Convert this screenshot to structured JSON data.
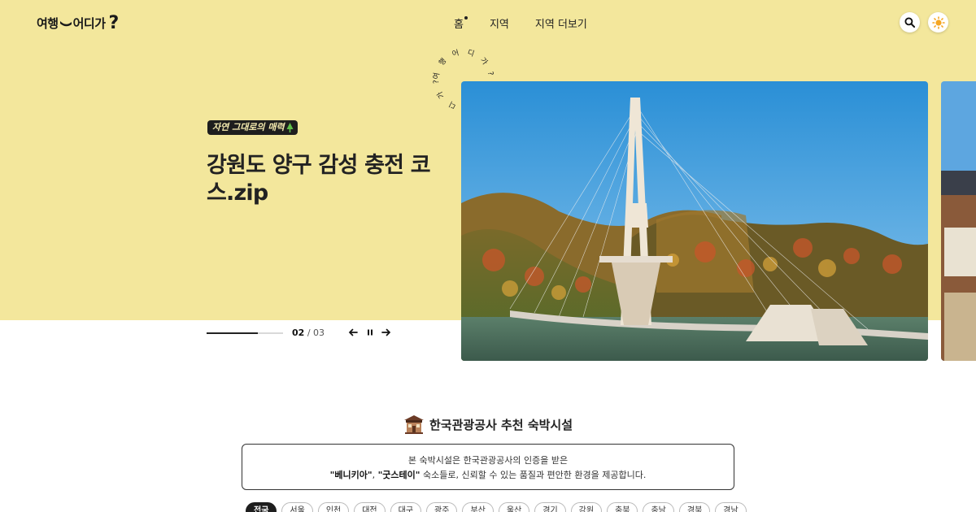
{
  "header": {
    "logo": {
      "part1": "여행",
      "part2": "어디가",
      "part3": "?"
    },
    "nav": [
      "홈",
      "지역",
      "지역 더보기"
    ],
    "active_nav": "홈"
  },
  "hero": {
    "circle_text": "여 행 어 디 가 ? 여 행 어 디 가 ?",
    "badge": "자연 그대로의 매력",
    "badge_icon": "tree-icon",
    "title": "강원도 양구 감성 충전 코스.zip",
    "slide_current": "02",
    "slide_separator": "/",
    "slide_total": "03",
    "progress": 0.67
  },
  "section": {
    "title": "한국관광공사 추천 숙박시설",
    "icon": "hanok-building-icon",
    "info_line1": "본 숙박시설은 한국관광공사의 인증을 받은",
    "info_brand1": "\"베니키아\"",
    "info_sep": ",",
    "info_brand2": "\"굿스테이\"",
    "info_rest": "숙소들로, 신뢰할 수 있는 품질과 편안한 환경을 제공합니다.",
    "chips": [
      "전국",
      "서울",
      "인천",
      "대전",
      "대구",
      "광주",
      "부산",
      "울산",
      "경기",
      "강원",
      "충북",
      "충남",
      "경북",
      "경남"
    ]
  },
  "colors": {
    "hero_bg": "#f3e79c",
    "dark": "#1e1e1e",
    "accent_sun": "#f5a623"
  }
}
